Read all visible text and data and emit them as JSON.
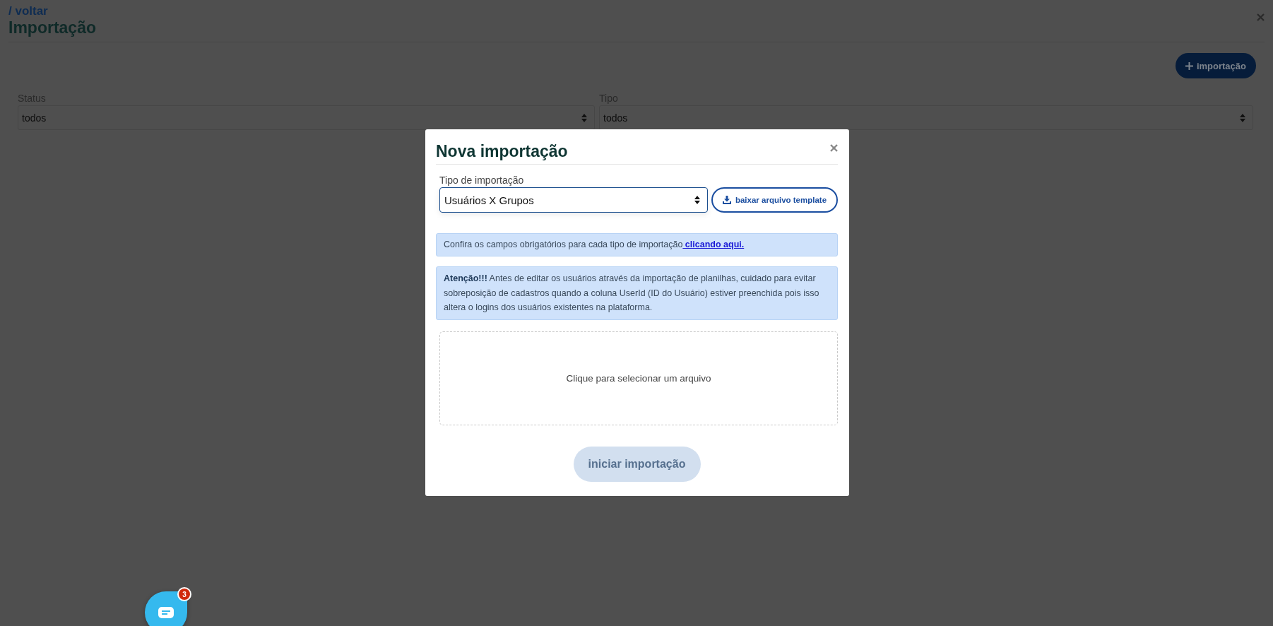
{
  "page": {
    "back_link": "/ voltar",
    "title": "Importação",
    "add_button": "importação",
    "filters": [
      {
        "label": "Status",
        "value": "todos"
      },
      {
        "label": "Tipo",
        "value": "todos"
      }
    ]
  },
  "modal": {
    "title": "Nova importação",
    "type_label": "Tipo de importação",
    "type_value": "Usuários X Grupos",
    "template_button": "baixar arquivo template",
    "info": {
      "text": "Confira os campos obrigatórios para cada tipo de importação",
      "link": " clicando aqui."
    },
    "warning": "**Atenção!!!** Antes de editar os usuários através da importação de planilhas, cuidado para evitar sobreposição de cadastros quando a coluna UserId (ID do Usuário) estiver preenchida pois isso altera o logins dos usuários existentes na plataforma.",
    "dropzone": "Clique para selecionar um arquivo",
    "submit": {
      "label": "iniciar importação",
      "disabled": true
    }
  },
  "chat": {
    "badge": "3"
  }
}
